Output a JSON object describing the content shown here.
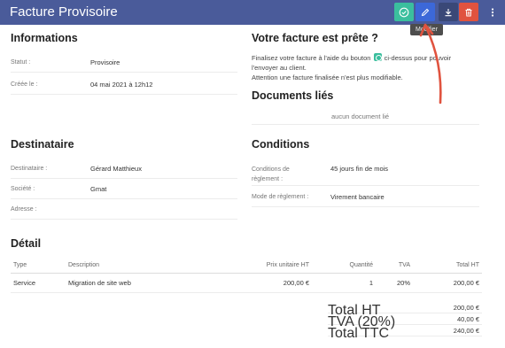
{
  "header": {
    "title": "Facture Provisoire",
    "tooltip": "Modifier",
    "colors": {
      "bar": "#4a5b9a",
      "validate": "#3bbf9e",
      "edit": "#3c68d8",
      "download": "#3a4877",
      "delete": "#e0533f"
    }
  },
  "informations": {
    "title": "Informations",
    "rows": [
      {
        "label": "Statut :",
        "value": "Provisoire"
      },
      {
        "label": "Créée le :",
        "value": "04 mai 2021 à 12h12"
      }
    ]
  },
  "ready": {
    "title": "Votre facture est prête ?",
    "line1_before": "Finalisez votre facture à l'aide du bouton",
    "line1_after": "ci-dessus pour pouvoir",
    "line2": "l'envoyer au client.",
    "line3": "Attention une facture finalisée n'est plus modifiable."
  },
  "documents": {
    "title": "Documents liés",
    "empty": "aucun document lié"
  },
  "destinataire": {
    "title": "Destinataire",
    "rows": [
      {
        "label": "Destinataire :",
        "value": "Gérard Matthieux"
      },
      {
        "label": "Société :",
        "value": "Gmat"
      },
      {
        "label": "Adresse :",
        "value": ""
      }
    ]
  },
  "conditions": {
    "title": "Conditions",
    "rows": [
      {
        "label": "Conditions de règlement :",
        "value": "45 jours fin de mois"
      },
      {
        "label": "Mode de règlement :",
        "value": "Virement bancaire"
      }
    ]
  },
  "detail": {
    "title": "Détail",
    "headers": [
      "Type",
      "Description",
      "Prix unitaire HT",
      "Quantité",
      "TVA",
      "Total HT"
    ],
    "lines": [
      [
        "Service",
        "Migration de site web",
        "200,00 €",
        "1",
        "20%",
        "200,00 €"
      ]
    ],
    "totals": [
      {
        "label": "Total HT",
        "value": "200,00 €"
      },
      {
        "label": "TVA (20%)",
        "value": "40,00 €"
      },
      {
        "label": "Total TTC",
        "value": "240,00 €"
      }
    ]
  }
}
